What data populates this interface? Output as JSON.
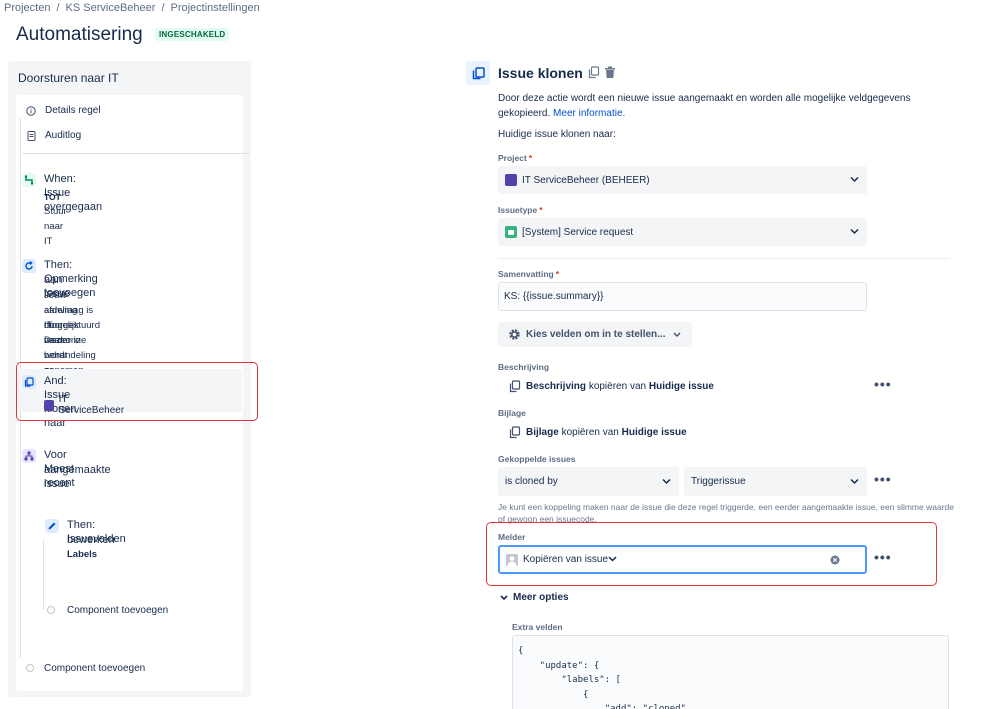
{
  "breadcrumb": [
    "Projecten",
    "KS ServiceBeheer",
    "Projectinstellingen"
  ],
  "page_title": "Automatisering",
  "status_badge": "INGESCHAKELD",
  "rule": {
    "title": "Doorsturen naar IT",
    "links": [
      {
        "label": "Details regel",
        "icon": "info-icon"
      },
      {
        "label": "Auditlog",
        "icon": "document-icon"
      }
    ],
    "steps": {
      "when": {
        "title": "When: Issue overgegaan",
        "line1": "TOT",
        "line2": "Stuur naar IT"
      },
      "then_comment": {
        "title1": "Then: Opmerking toevoegen",
        "title2": "aan issue",
        "desc": [
          "Jouw aanvraag is doorgestuurd naar onze",
          "afdeling IT. Deze wordt zo spoedig",
          "mogelijk verder in behandeling genomen."
        ]
      },
      "and_clone": {
        "title": "And: Issue klonen naar",
        "project": "IT ServiceBeheer"
      },
      "branch": {
        "title1": "Voor Meest recent",
        "title2": "aangemaakte issue"
      },
      "then_edit": {
        "title1": "Then: Issuevelden",
        "title2": "bewerken",
        "sub": "Labels"
      },
      "add_component_inner": "Component toevoegen",
      "add_component_outer": "Component toevoegen"
    }
  },
  "action": {
    "title": "Issue klonen",
    "description": "Door deze actie wordt een nieuwe issue aangemaakt en worden alle mogelijke veldgegevens gekopieerd.",
    "more_info_link": "Meer informatie.",
    "subtitle": "Huidige issue klonen naar:",
    "project": {
      "label": "Project",
      "value": "IT ServiceBeheer (BEHEER)"
    },
    "issuetype": {
      "label": "Issuetype",
      "value": "[System] Service request"
    },
    "summary": {
      "label": "Samenvatting",
      "value": "KS: {{issue.summary}}"
    },
    "choose_fields_button": "Kies velden om in te stellen...",
    "description_field": {
      "label": "Beschrijving",
      "field": "Beschrijving",
      "middle": "kopiëren van",
      "source": "Huidige issue"
    },
    "attachment_field": {
      "label": "Bijlage",
      "field": "Bijlage",
      "middle": "kopiëren van",
      "source": "Huidige issue"
    },
    "linked_issues": {
      "label": "Gekoppelde issues",
      "link_type": "is cloned by",
      "target": "Triggerissue",
      "hint": "Je kunt een koppeling maken naar de issue die deze regel triggerde, een eerder aangemaakte issue, een slimme waarde of gewoon een issuecode."
    },
    "reporter": {
      "label": "Melder",
      "value": "Kopiëren van issue"
    },
    "more_options": "Meer opties",
    "extra_fields_label": "Extra velden",
    "extra_fields_code": "{\n    \"update\": {\n        \"labels\": [\n            {\n                \"add\": \"cloned\""
  },
  "colors": {
    "accent": "#0052cc",
    "highlight": "#e5353b",
    "badge_bg": "#e3fcef",
    "badge_text": "#006644"
  }
}
